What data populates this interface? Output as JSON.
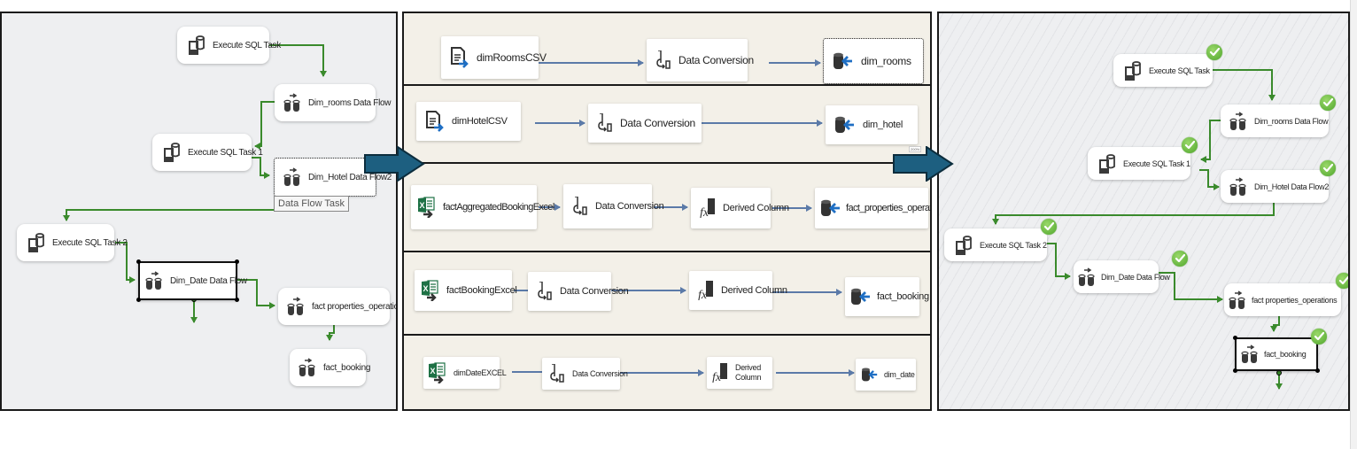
{
  "control_flow": {
    "nodes": {
      "exec_sql": "Execute SQL Task",
      "dim_rooms_df": "Dim_rooms Data Flow",
      "exec_sql_1": "Execute SQL Task 1",
      "dim_hotel_df": "Dim_Hotel Data Flow2",
      "exec_sql_2": "Execute SQL Task 2",
      "dim_date_df": "Dim_Date Data Flow",
      "fact_props": "fact properties_operations",
      "fact_booking": "fact_booking"
    },
    "tooltip": "Data Flow Task"
  },
  "data_flows": [
    {
      "source": "dimRoomsCSV",
      "source_type": "flat-file",
      "steps": [
        "Data Conversion"
      ],
      "destination": "dim_rooms"
    },
    {
      "source": "dimHotelCSV",
      "source_type": "flat-file",
      "steps": [
        "Data Conversion"
      ],
      "destination": "dim_hotel",
      "zoom": "200%"
    },
    {
      "source": "factAggregatedBookingExcel",
      "source_type": "excel",
      "steps": [
        "Data Conversion",
        "Derived Column"
      ],
      "destination": "fact_properties_operations"
    },
    {
      "source": "factBookingExcel",
      "source_type": "excel",
      "steps": [
        "Data Conversion",
        "Derived Column"
      ],
      "destination": "fact_booking"
    },
    {
      "source": "dimDateEXCEL",
      "source_type": "excel",
      "steps": [
        "Data Conversion",
        "Derived Column"
      ],
      "destination": "dim_date"
    }
  ],
  "execution": {
    "nodes": {
      "exec_sql": "Execute SQL Task",
      "dim_rooms_df": "Dim_rooms Data Flow",
      "exec_sql_1": "Execute SQL Task 1",
      "dim_hotel_df": "Dim_Hotel Data Flow2",
      "exec_sql_2": "Execute SQL Task 2",
      "dim_date_df": "Dim_Date Data Flow",
      "fact_props": "fact properties_operations",
      "fact_booking": "fact_booking"
    },
    "status": "success"
  },
  "colors": {
    "precedence_green": "#3a8a2c",
    "path_blue": "#5b7aa8",
    "arrow_fill": "#1d5f80",
    "success_green": "#5cb234"
  }
}
